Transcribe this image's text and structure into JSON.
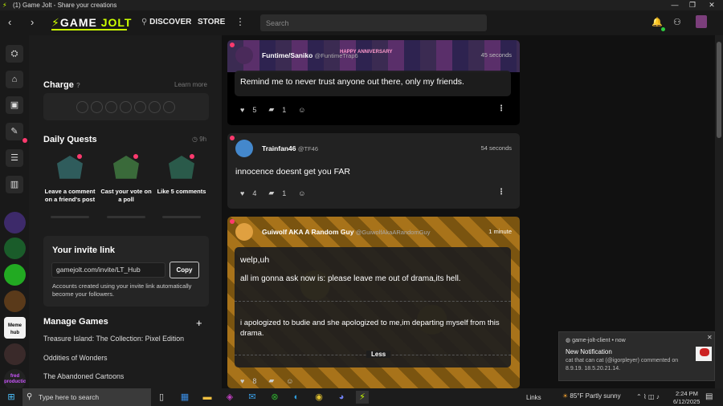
{
  "window": {
    "title": "(1) Game Jolt - Share your creations"
  },
  "header": {
    "logo_prefix": "GAME ",
    "logo_suffix": "JOLT",
    "discover": "DISCOVER",
    "store": "STORE",
    "search_placeholder": "Search"
  },
  "sidebar": {
    "charge": {
      "title": "Charge",
      "learn_more": "Learn more"
    },
    "daily_quests": {
      "title": "Daily Quests",
      "time": "9h",
      "quests": [
        {
          "label": "Leave a comment on a friend's post"
        },
        {
          "label": "Cast your vote on a poll"
        },
        {
          "label": "Like 5 comments"
        }
      ]
    },
    "invite": {
      "title": "Your invite link",
      "link": "gamejolt.com/invite/LT_Hub",
      "copy": "Copy",
      "note": "Accounts created using your invite link automatically become your followers."
    },
    "manage_games": {
      "title": "Manage Games",
      "add": "+",
      "games": [
        "Treasure Island: The Collection: Pixel Edition",
        "Oddities of Wonders",
        "The Abandoned Cartoons"
      ]
    },
    "channels": [
      {
        "label": ""
      },
      {
        "label": ""
      },
      {
        "label": ""
      },
      {
        "label": ""
      },
      {
        "label": "Meme hub"
      },
      {
        "label": ""
      },
      {
        "label": "fred production"
      }
    ]
  },
  "posts": [
    {
      "user": "Funtime/Saniko",
      "handle": "@FuntimeTrap6",
      "time": "45 seconds",
      "text": "Remind me to never trust anyone out there, only my friends.",
      "likes": "5",
      "comments": "1",
      "banner_text": "HAPPY ANNIVERSARY"
    },
    {
      "user": "Trainfan46",
      "handle": "@TF46",
      "time": "54 seconds",
      "text": "innocence doesnt get you FAR",
      "likes": "4",
      "comments": "1"
    },
    {
      "user": "Guiwolf AKA A Random Guy",
      "handle": "@GuiwolfAkaARandomGuy",
      "time": "1 minute",
      "paragraphs": [
        "welp,uh",
        "all im gonna ask now is: please leave me out of drama,its hell.",
        "i apologized to budie and she apologized to me,im departing myself from this drama."
      ],
      "less": "Less",
      "likes": "8"
    }
  ],
  "notification": {
    "source": "game-jolt-client",
    "when": "now",
    "title": "New Notification",
    "body": "cat that can cat (@igorpleyer) commented on 8.9.19. 18.5.20.21.14."
  },
  "taskbar": {
    "search_placeholder": "Type here to search",
    "links": "Links",
    "weather": "85°F  Partly sunny",
    "time": "2:24 PM",
    "date": "6/12/2025"
  },
  "colors": {
    "accent": "#ccff00",
    "notify": "#ff3a6e",
    "background": "#191919"
  }
}
